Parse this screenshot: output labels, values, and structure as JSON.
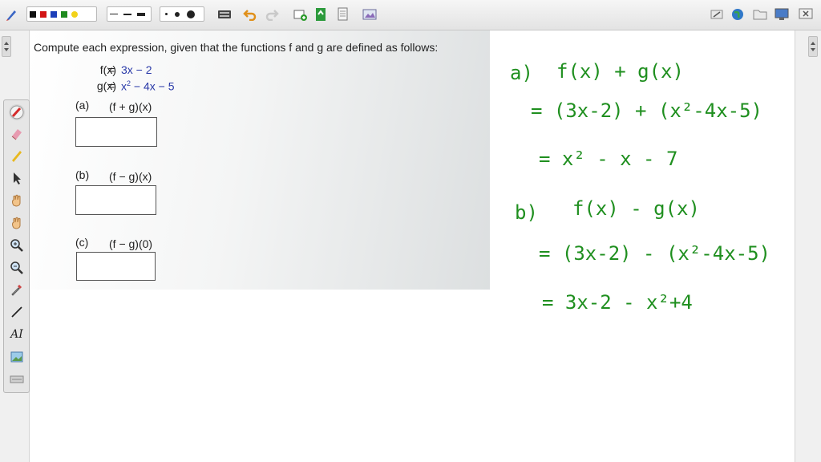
{
  "toolbar": {
    "colors": [
      "#111111",
      "#d21414",
      "#1d3fb8",
      "#1f8a1f",
      "#f2d21a"
    ],
    "line_widths": [
      "thin",
      "medium",
      "thick"
    ],
    "dot_sizes": [
      "small",
      "medium",
      "large"
    ],
    "icons_left": [
      "pen-icon",
      "keyboard-icon",
      "undo-icon",
      "redo-icon",
      "add-page-icon",
      "screenshot-icon",
      "document-icon",
      "insert-image-icon"
    ],
    "icons_right": [
      "clear-icon",
      "globe-icon",
      "folder-icon",
      "display-icon",
      "close-icon"
    ]
  },
  "palette": {
    "tools": [
      "color-pen-icon",
      "eraser-icon",
      "highlighter-icon",
      "pointer-icon",
      "hand-icon",
      "pan-icon",
      "zoom-in-icon",
      "zoom-out-icon",
      "eyedropper-icon",
      "line-icon",
      "text-tool-icon",
      "image-tool-icon",
      "menu-icon"
    ],
    "text_tool_label": "AI"
  },
  "problem": {
    "intro": "Compute each expression, given that the functions f and g are defined as follows:",
    "f_label": "f(x)",
    "g_label": "g(x)",
    "eq": "=",
    "f_expr": "3x − 2",
    "g_expr_a": "x",
    "g_expr_sup": "2",
    "g_expr_b": " − 4x − 5",
    "parts": [
      {
        "label": "(a)",
        "expr": "(f + g)(x)"
      },
      {
        "label": "(b)",
        "expr": "(f − g)(x)"
      },
      {
        "label": "(c)",
        "expr": "(f − g)(0)"
      }
    ]
  },
  "handwriting": {
    "a_label": "a)",
    "a_line1": "f(x) + g(x)",
    "a_line2": "= (3x-2) + (x²-4x-5)",
    "a_line3": "= x² - x - 7",
    "b_label": "b)",
    "b_line1": "f(x) - g(x)",
    "b_line2": "= (3x-2) - (x²-4x-5)",
    "b_line3": "= 3x-2 - x²+4"
  }
}
